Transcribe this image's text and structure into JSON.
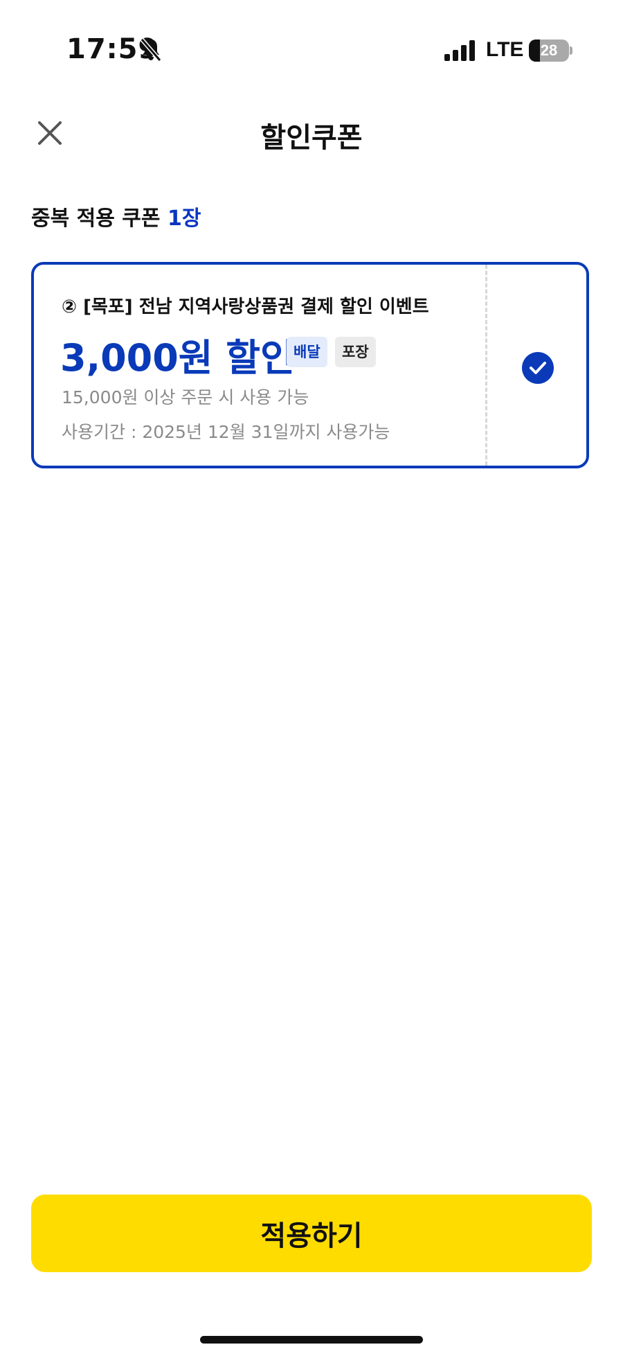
{
  "status_bar": {
    "time": "17:59",
    "network": "LTE",
    "battery_level": "28",
    "battery_fraction": 0.28,
    "icons": [
      "bell-slash-icon",
      "signal-bars-icon",
      "battery-icon"
    ]
  },
  "header": {
    "title": "할인쿠폰",
    "close_icon": "close-icon"
  },
  "coupon_count": {
    "label": "중복 적용 쿠폰",
    "value": "1장"
  },
  "coupons": [
    {
      "name": "② [목포] 전남 지역사랑상품권 결제 할인 이벤트",
      "amount": "3,000원 할인",
      "tags": [
        "배달",
        "포장"
      ],
      "condition": "15,000원 이상 주문 시 사용 가능",
      "period": "사용기간 : 2025년 12월 31일까지 사용가능",
      "selected": true
    }
  ],
  "apply_button": {
    "label": "적용하기"
  },
  "colors": {
    "accent_blue": "#0a3ab8",
    "button_yellow": "#ffdc00",
    "muted_text": "#8a8a8a"
  }
}
